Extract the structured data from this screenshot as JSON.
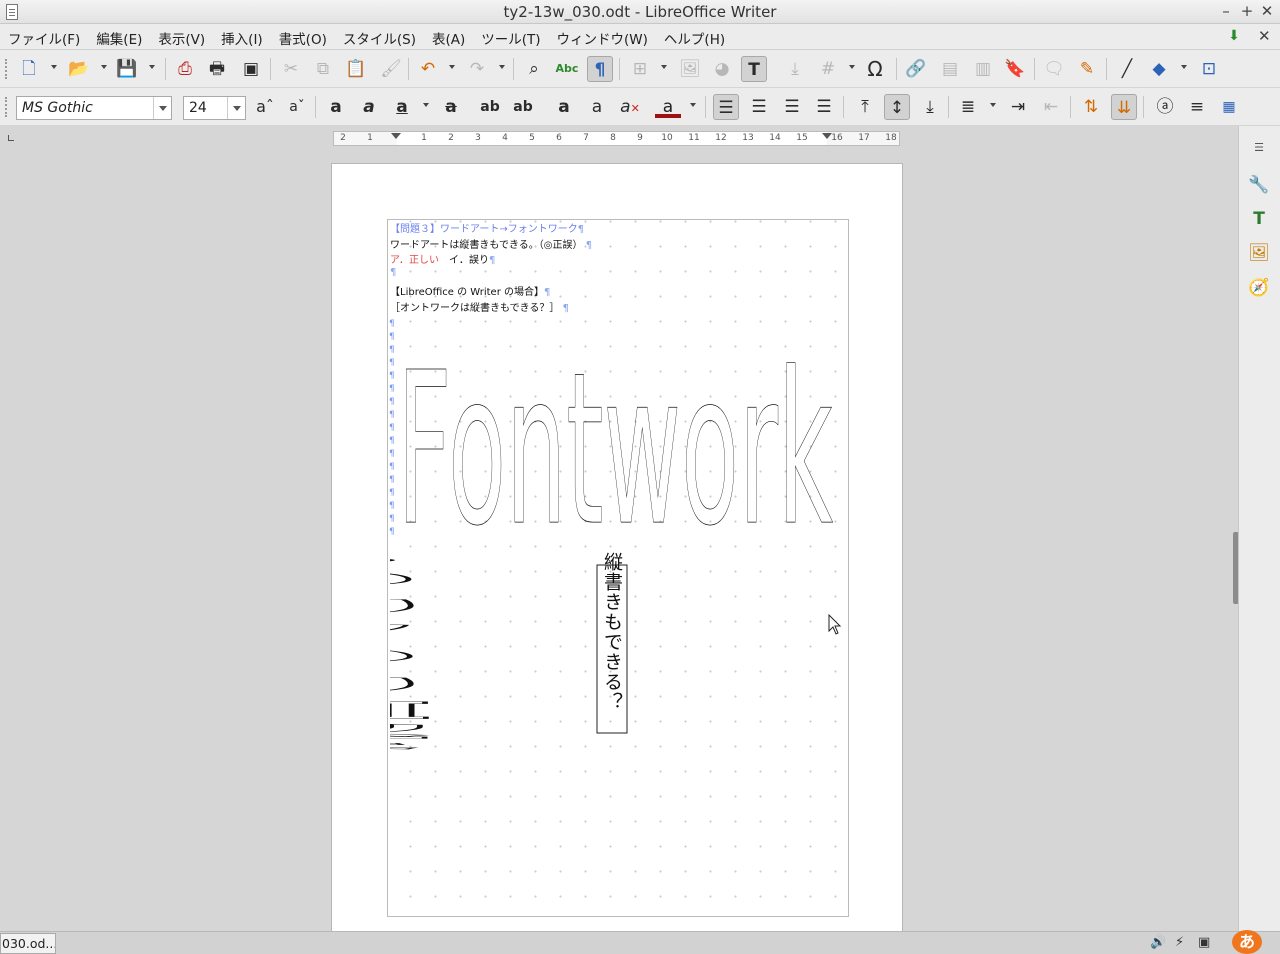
{
  "window": {
    "title": "ty2-13w_030.odt - LibreOffice Writer",
    "minimize": "–",
    "maximize": "+",
    "close": "✕"
  },
  "menu": [
    "ファイル(F)",
    "編集(E)",
    "表示(V)",
    "挿入(I)",
    "書式(O)",
    "スタイル(S)",
    "表(A)",
    "ツール(T)",
    "ウィンドウ(W)",
    "ヘルプ(H)"
  ],
  "menu_close": "✕",
  "toolbar_formatting": {
    "font_name": "MS Gothic",
    "font_size": "24"
  },
  "document": {
    "line1": "【問題３】ワードアート→フォントワーク",
    "line2": "ワードアートは縦書きもできる。（◎正誤）",
    "line3_a": "ア．正しい",
    "line3_b": "イ．誤り",
    "line5": "【LibreOffice の Writer の場合】",
    "line6": "［オントワークは縦書きもできる？］",
    "pilcrow": "¶",
    "fontwork_word": "Fontwork",
    "fontwork_vertical": "縦書きもできる？",
    "vertical_text": "縦書きもできる？"
  },
  "ruler_numbers": [
    "2",
    "1",
    "1",
    "2",
    "3",
    "4",
    "5",
    "6",
    "7",
    "8",
    "9",
    "10",
    "11",
    "12",
    "13",
    "14",
    "15",
    "16",
    "17",
    "18"
  ],
  "status": {
    "task": "030.od...",
    "ime": "あ"
  },
  "icons": {
    "undo": "↶",
    "redo": "↷",
    "omega": "Ω",
    "pilcrow": "¶",
    "spell": "Abc",
    "bold_a": "a",
    "search": "⌕",
    "line": "╱",
    "diamond": "◆",
    "cut": "✂"
  }
}
